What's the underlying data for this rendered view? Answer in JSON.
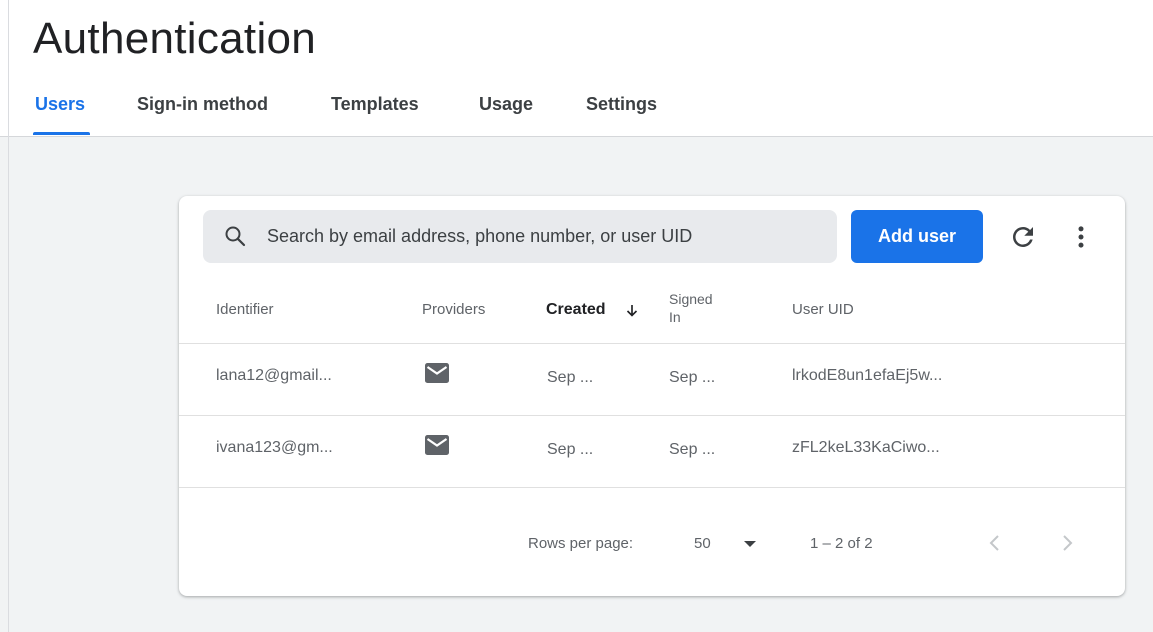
{
  "page": {
    "title": "Authentication"
  },
  "tabs": [
    {
      "label": "Users",
      "active": true
    },
    {
      "label": "Sign-in method",
      "active": false
    },
    {
      "label": "Templates",
      "active": false
    },
    {
      "label": "Usage",
      "active": false
    },
    {
      "label": "Settings",
      "active": false
    }
  ],
  "toolbar": {
    "search_placeholder": "Search by email address, phone number, or user UID",
    "search_value": "",
    "add_user_label": "Add user",
    "search_icon": "search-icon",
    "refresh_icon": "refresh-icon",
    "more_icon": "more-vert-icon"
  },
  "table": {
    "columns": {
      "identifier": "Identifier",
      "providers": "Providers",
      "created": "Created",
      "signed_in_line1": "Signed",
      "signed_in_line2": "In",
      "user_uid": "User UID"
    },
    "sort_icon": "arrow-down-icon",
    "rows": [
      {
        "identifier": "lana12@gmail...",
        "provider_icon": "email-icon",
        "created": "Sep ...",
        "signed_in": "Sep ...",
        "uid": "lrkodE8un1efaEj5w..."
      },
      {
        "identifier": "ivana123@gm...",
        "provider_icon": "email-icon",
        "created": "Sep ...",
        "signed_in": "Sep ...",
        "uid": "zFL2keL33KaCiwo..."
      }
    ]
  },
  "pagination": {
    "rows_per_page_label": "Rows per page:",
    "rows_per_page_value": "50",
    "range_label": "1 – 2 of 2"
  },
  "colors": {
    "accent": "#1a73e8",
    "background": "#f1f3f4",
    "card": "#ffffff"
  }
}
